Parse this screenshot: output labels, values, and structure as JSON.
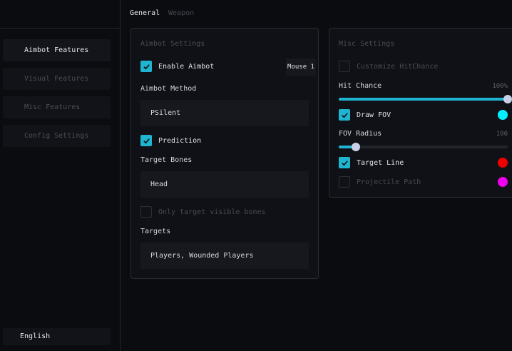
{
  "sidebar": {
    "items": [
      {
        "label": "Aimbot Features",
        "active": true
      },
      {
        "label": "Visual Features",
        "active": false
      },
      {
        "label": "Misc Features",
        "active": false
      },
      {
        "label": "Config Settings",
        "active": false
      }
    ],
    "language": "English"
  },
  "tabs": [
    {
      "label": "General",
      "active": true
    },
    {
      "label": "Weapon",
      "active": false
    }
  ],
  "aimbot": {
    "title": "Aimbot Settings",
    "enable_label": "Enable Aimbot",
    "enable_checked": true,
    "keybind": "Mouse 1",
    "method_label": "Aimbot Method",
    "method_value": "PSilent",
    "prediction_label": "Prediction",
    "prediction_checked": true,
    "bones_label": "Target Bones",
    "bones_value": "Head",
    "visible_bones_label": "Only target visible bones",
    "visible_bones_checked": false,
    "targets_label": "Targets",
    "targets_value": "Players, Wounded Players"
  },
  "misc": {
    "title": "Misc Settings",
    "hitchance_label": "Customize HitChance",
    "hitchance_checked": false,
    "hit_chance_slider_label": "Hit Chance",
    "hit_chance_value": "100%",
    "hit_chance_fraction": 1.0,
    "draw_fov_label": "Draw FOV",
    "draw_fov_checked": true,
    "draw_fov_color": "#00f0ff",
    "fov_radius_label": "FOV Radius",
    "fov_radius_value": "100",
    "fov_radius_fraction": 0.1,
    "target_line_label": "Target Line",
    "target_line_checked": true,
    "target_line_color": "#f00000",
    "projectile_path_label": "Projectile Path",
    "projectile_path_checked": false,
    "projectile_path_color": "#f000f0"
  },
  "colors": {
    "accent": "#1fb5d0",
    "background": "#0b0c10",
    "panel": "#101116"
  }
}
